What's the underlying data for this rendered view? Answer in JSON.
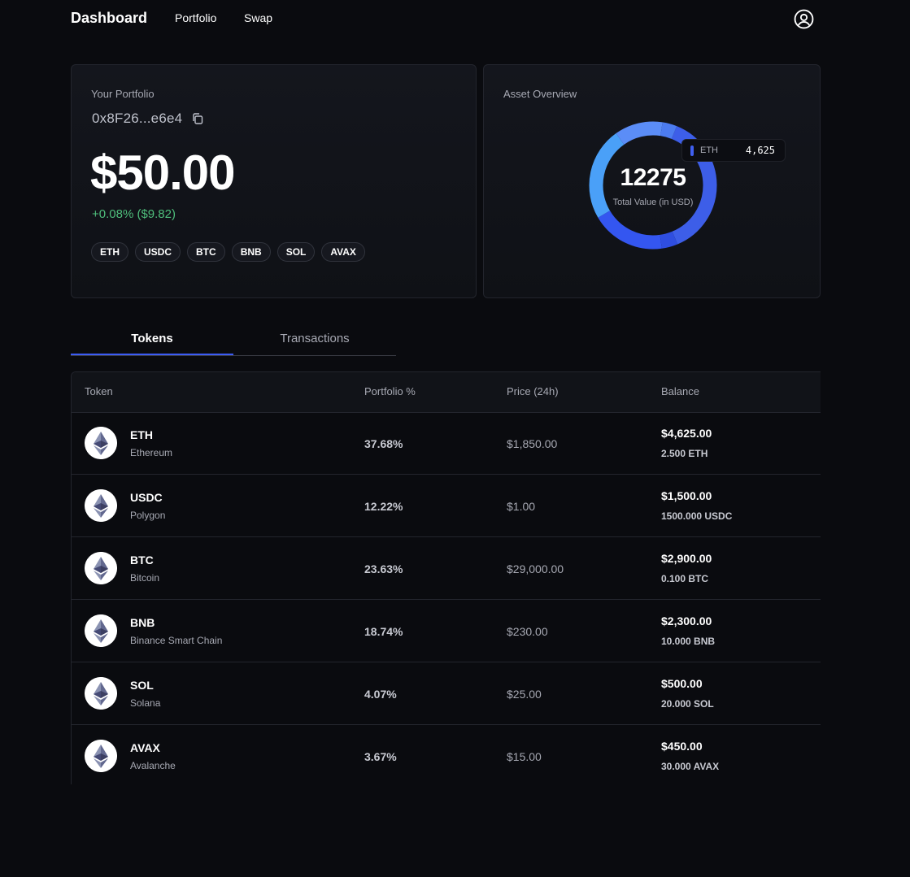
{
  "nav": {
    "brand": "Dashboard",
    "links": [
      "Portfolio",
      "Swap"
    ],
    "user_icon": "user-circle-icon"
  },
  "portfolio": {
    "label": "Your Portfolio",
    "address": "0x8F26...e6e4",
    "copy_icon": "copy-icon",
    "total_value": "$50.00",
    "change": "+0.08% ($9.82)",
    "change_color": "#4fbf7c",
    "chips": [
      "ETH",
      "USDC",
      "BTC",
      "BNB",
      "SOL",
      "AVAX"
    ]
  },
  "overview": {
    "label": "Asset Overview",
    "total": "12275",
    "total_caption": "Total Value (in USD)",
    "tooltip": {
      "label": "ETH",
      "value": "4,625",
      "color": "#3f5ff0"
    },
    "segments": [
      {
        "label": "ETH",
        "value": 4625,
        "color": "#3d5ee8"
      },
      {
        "label": "USDC",
        "value": 1500,
        "color": "#5b8df7"
      },
      {
        "label": "BTC",
        "value": 2900,
        "color": "#4aa0f8"
      },
      {
        "label": "BNB",
        "value": 2300,
        "color": "#3456f0"
      },
      {
        "label": "SOL",
        "value": 500,
        "color": "#2f4ee0"
      },
      {
        "label": "AVAX",
        "value": 450,
        "color": "#4c7cf0"
      }
    ]
  },
  "tabs": {
    "tokens": "Tokens",
    "transactions": "Transactions"
  },
  "table": {
    "headers": {
      "token": "Token",
      "portfolio_pct": "Portfolio %",
      "price": "Price (24h)",
      "balance": "Balance"
    },
    "rows": [
      {
        "symbol": "ETH",
        "name": "Ethereum",
        "pct": "37.68%",
        "price": "$1,850.00",
        "balance": "$4,625.00",
        "qty": "2.500 ETH",
        "icon": "ethereum-icon"
      },
      {
        "symbol": "USDC",
        "name": "Polygon",
        "pct": "12.22%",
        "price": "$1.00",
        "balance": "$1,500.00",
        "qty": "1500.000 USDC",
        "icon": "ethereum-icon"
      },
      {
        "symbol": "BTC",
        "name": "Bitcoin",
        "pct": "23.63%",
        "price": "$29,000.00",
        "balance": "$2,900.00",
        "qty": "0.100 BTC",
        "icon": "ethereum-icon"
      },
      {
        "symbol": "BNB",
        "name": "Binance Smart Chain",
        "pct": "18.74%",
        "price": "$230.00",
        "balance": "$2,300.00",
        "qty": "10.000 BNB",
        "icon": "ethereum-icon"
      },
      {
        "symbol": "SOL",
        "name": "Solana",
        "pct": "4.07%",
        "price": "$25.00",
        "balance": "$500.00",
        "qty": "20.000 SOL",
        "icon": "ethereum-icon"
      },
      {
        "symbol": "AVAX",
        "name": "Avalanche",
        "pct": "3.67%",
        "price": "$15.00",
        "balance": "$450.00",
        "qty": "30.000 AVAX",
        "icon": "ethereum-icon"
      }
    ]
  }
}
